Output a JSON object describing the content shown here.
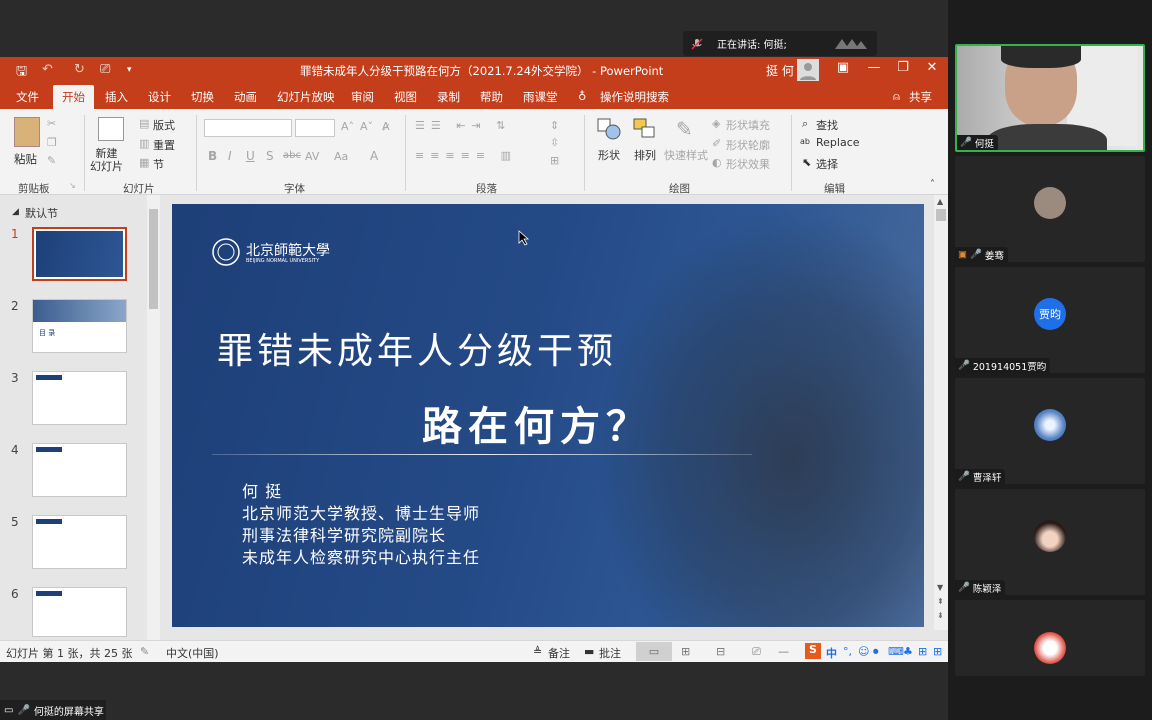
{
  "speaker": {
    "label": "正在讲话: 何挺;"
  },
  "ppt": {
    "title": "罪错未成年人分级干预路在何方（2021.7.24外交学院） - PowerPoint",
    "user": "挺 何",
    "tabs": [
      "文件",
      "开始",
      "插入",
      "设计",
      "切换",
      "动画",
      "幻灯片放映",
      "审阅",
      "视图",
      "录制",
      "帮助",
      "雨课堂"
    ],
    "tell_me": "操作说明搜索",
    "share": "共享",
    "ribbon": {
      "paste": "粘贴",
      "clipboard": "剪贴板",
      "new_slide": "新建\n幻灯片",
      "layout": "版式",
      "reset": "重置",
      "section": "节",
      "slides_group": "幻灯片",
      "font_group": "字体",
      "paragraph_group": "段落",
      "shape": "形状",
      "arrange": "排列",
      "quick_styles": "快速样式",
      "shape_fill": "形状填充",
      "shape_outline": "形状轮廓",
      "shape_effects": "形状效果",
      "drawing_group": "绘图",
      "find": "查找",
      "replace": "Replace",
      "select": "选择",
      "editing_group": "编辑"
    },
    "section_name": "默认节",
    "slide_numbers": [
      "1",
      "2",
      "3",
      "4",
      "5",
      "6"
    ],
    "thumb2_title": "目 录",
    "slide": {
      "logo_text": "北京師範大學",
      "logo_sub": "BEIJING NORMAL UNIVERSITY",
      "title_line1": "罪错未成年人分级干预",
      "title_line2": "路在何方？",
      "author": "何   挺",
      "line1": "北京师范大学教授、博士生导师",
      "line2": "刑事法律科学研究院副院长",
      "line3": "未成年人检察研究中心执行主任"
    },
    "status": {
      "slide_count": "幻灯片 第 1 张，共 25 张",
      "language": "中文(中国)",
      "notes": "备注",
      "comments": "批注"
    }
  },
  "share_bar": "何挺的屏幕共享",
  "participants": [
    {
      "name": "何挺",
      "avatar": ""
    },
    {
      "name": "姜骞",
      "avatar": ""
    },
    {
      "name": "201914051贾昀",
      "avatar": "贾昀"
    },
    {
      "name": "曹泽轩",
      "avatar": ""
    },
    {
      "name": "陈颖泽",
      "avatar": ""
    },
    {
      "name": "",
      "avatar": ""
    }
  ],
  "colors": {
    "ppt_accent": "#c43e1c",
    "active_speaker": "#34b34a",
    "avatar_blue": "#1e6fe8"
  }
}
